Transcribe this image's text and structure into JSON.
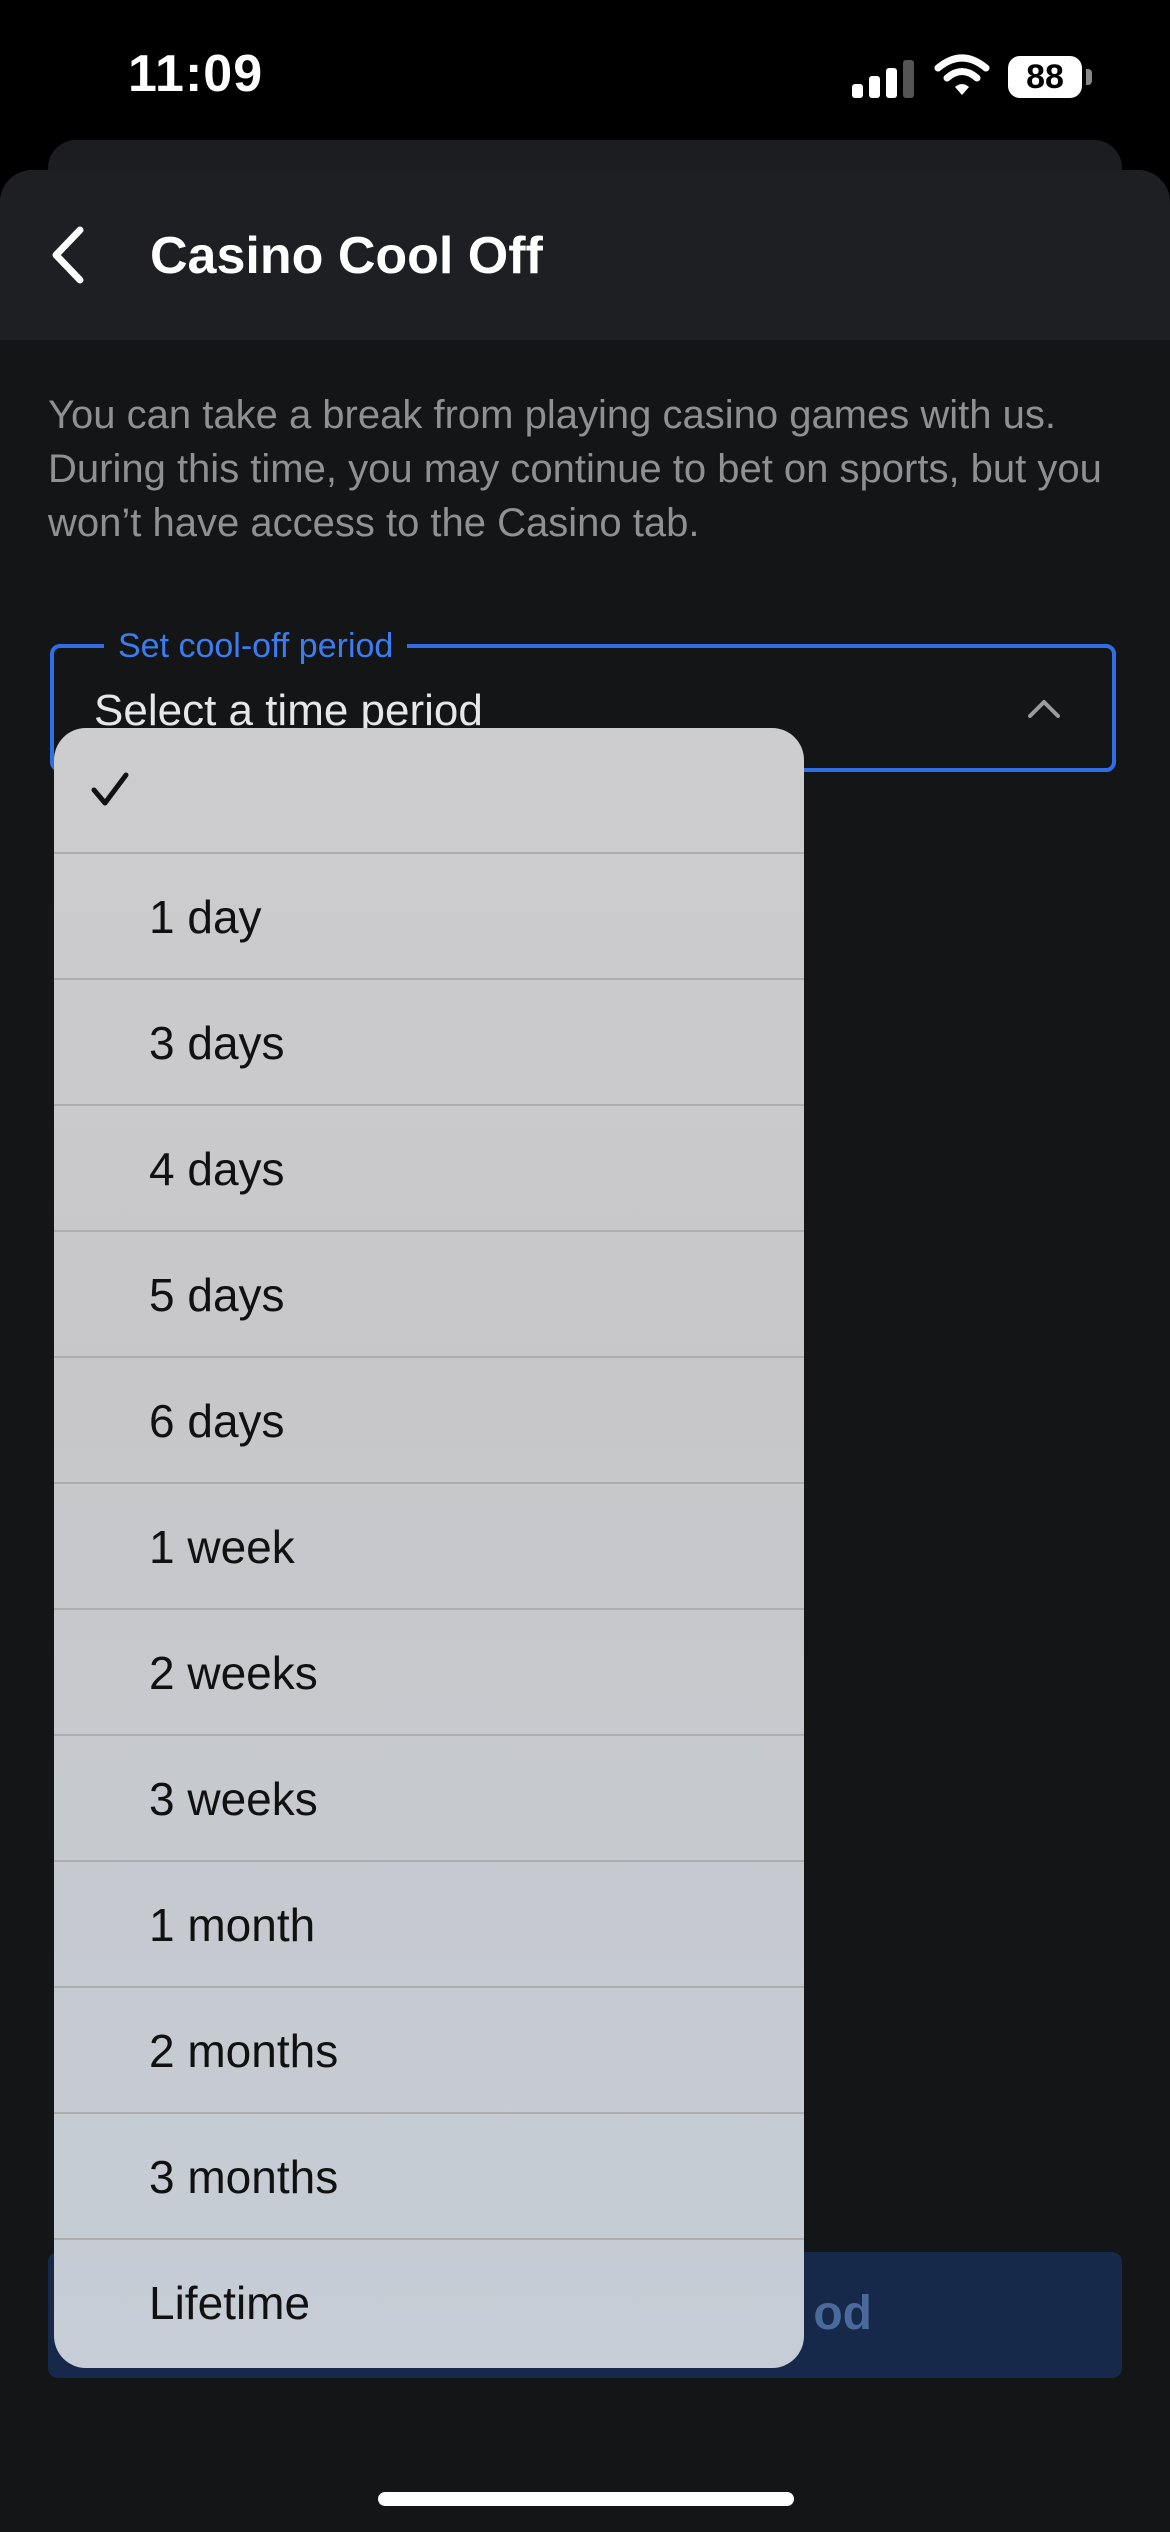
{
  "status_bar": {
    "time": "11:09",
    "battery": "88",
    "signal_icon": "cellular-signal-icon",
    "wifi_icon": "wifi-icon"
  },
  "header": {
    "title": "Casino Cool Off",
    "back_icon": "chevron-left-icon"
  },
  "description": "You can take a break from playing casino games with us. During this time, you may continue to bet on sports, but you won’t have access to the Casino tab.",
  "select": {
    "label": "Set cool-off period",
    "value": "Select a time period",
    "icon": "chevron-up-icon"
  },
  "dropdown": {
    "selected_icon": "checkmark-icon",
    "options": [
      "",
      "1 day",
      "3 days",
      "4 days",
      "5 days",
      "6 days",
      "1 week",
      "2 weeks",
      "3 weeks",
      "1 month",
      "2 months",
      "3 months",
      "Lifetime"
    ]
  },
  "submit_button": {
    "visible_label": "od"
  },
  "colors": {
    "accent": "#2f6fe6",
    "background": "#141517",
    "header": "#1e1f22",
    "dropdown": "#c9c9cb"
  }
}
